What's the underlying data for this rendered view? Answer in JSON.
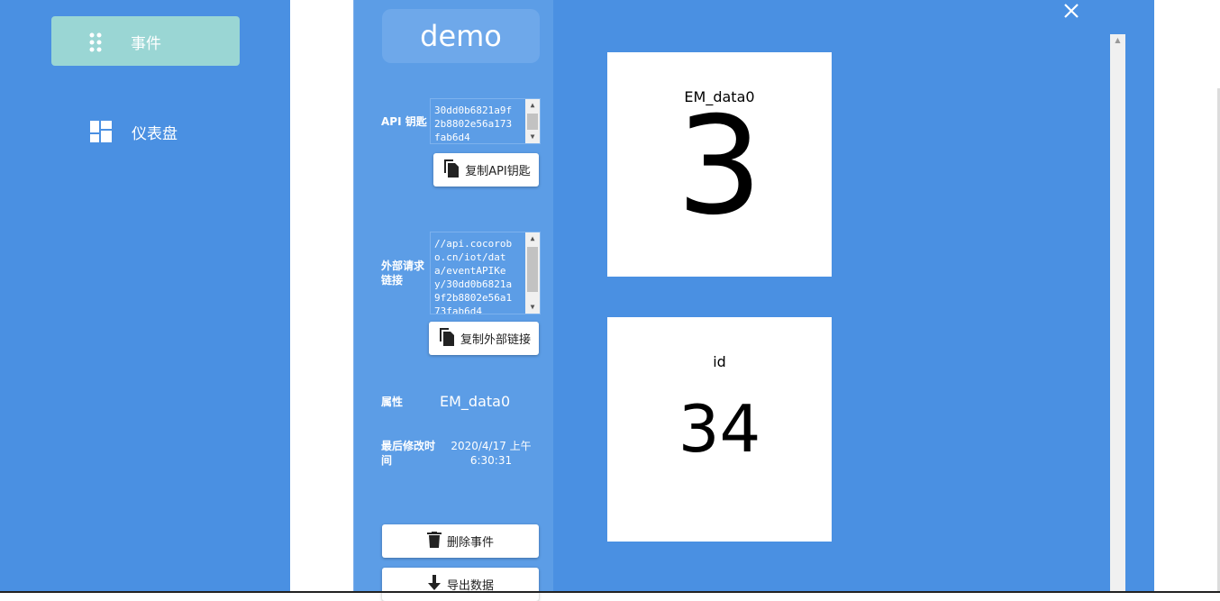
{
  "sidebar": {
    "items": [
      {
        "label": "事件",
        "icon": "drag-dots-icon",
        "active": true
      },
      {
        "label": "仪表盘",
        "icon": "dashboard-grid-icon",
        "active": false
      }
    ],
    "active_bg": "#9ad6d4",
    "bg": "#4a90e2"
  },
  "modal": {
    "title": "demo",
    "api_key": {
      "label": "API 钥匙",
      "value": "30dd0b6821a9f2b8802e56a173fab6d4",
      "copy_button": "复制API钥匙"
    },
    "external_link": {
      "label": "外部请求链接",
      "value": "//api.cocorobo.cn/iot/data/eventAPIKey/30dd0b6821a9f2b8802e56a173fab6d4",
      "copy_button": "复制外部链接"
    },
    "attribute": {
      "label": "属性",
      "value": "EM_data0"
    },
    "modified": {
      "label": "最后修改时间",
      "value": "2020/4/17 上午6:30:31"
    },
    "delete_button": "删除事件",
    "export_button": "导出数据"
  },
  "cards": [
    {
      "name": "EM_data0",
      "value": "3"
    },
    {
      "name": "id",
      "value": "34"
    }
  ],
  "colors": {
    "panel": "#5c9de6",
    "modal": "#4a90e2",
    "card": "#ffffff"
  }
}
